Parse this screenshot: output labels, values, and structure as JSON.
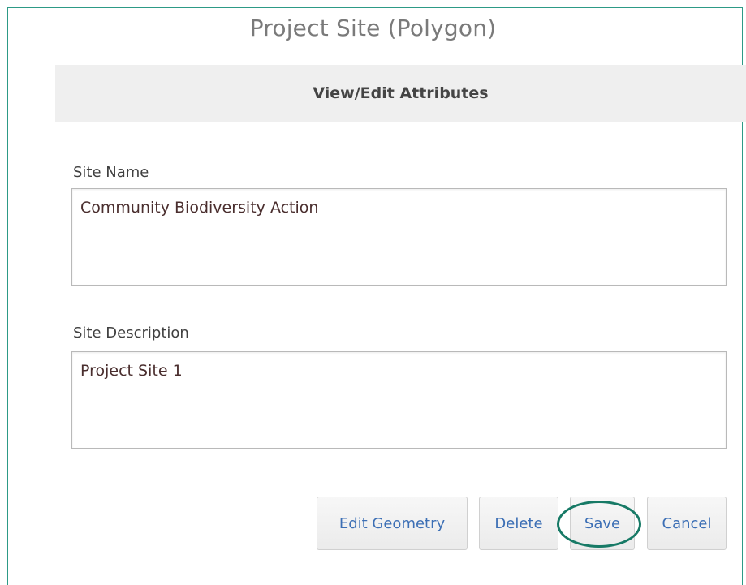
{
  "popup": {
    "title": "Project Site (Polygon)",
    "section_header": "View/Edit Attributes"
  },
  "fields": {
    "site_name": {
      "label": "Site Name",
      "value": "Community Biodiversity Action"
    },
    "site_description": {
      "label": "Site Description",
      "value": "Project Site 1"
    }
  },
  "buttons": {
    "edit_geometry": "Edit Geometry",
    "delete": "Delete",
    "save": "Save",
    "cancel": "Cancel"
  },
  "colors": {
    "frame_border": "#2d9a86",
    "button_text": "#3c6fb5",
    "highlight": "#177a66"
  }
}
